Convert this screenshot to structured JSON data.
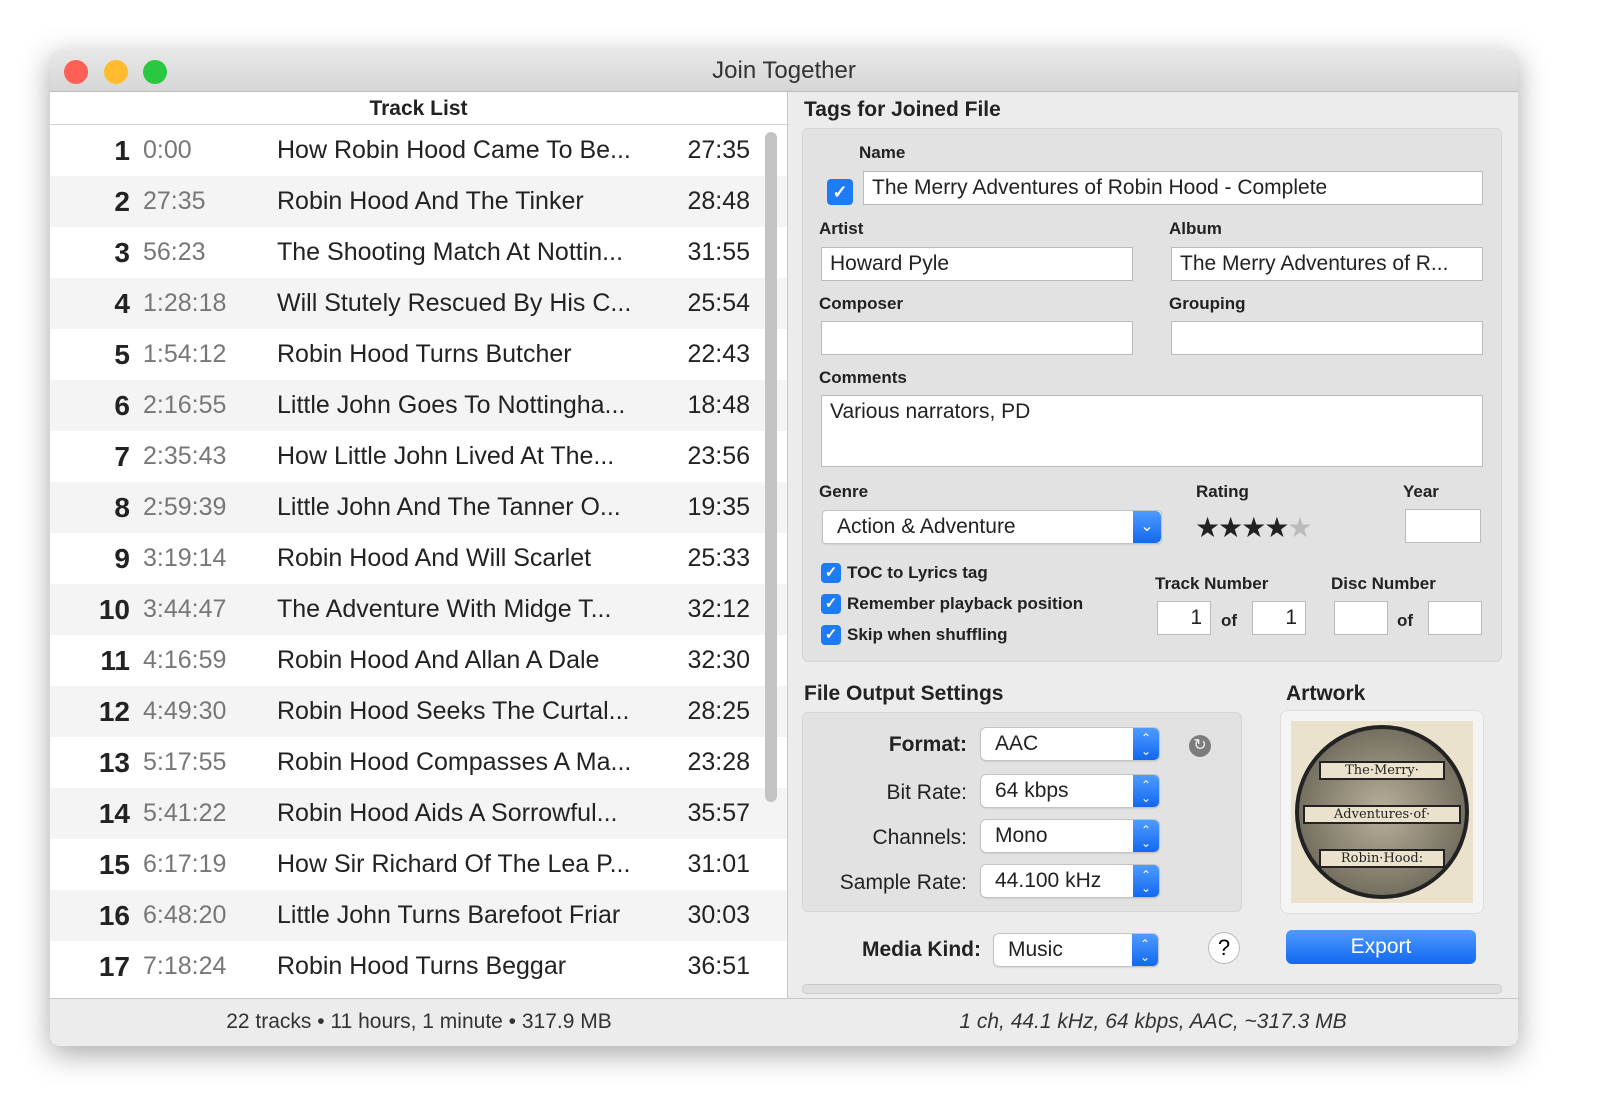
{
  "window": {
    "title": "Join Together"
  },
  "track_list": {
    "header": "Track List",
    "tracks": [
      {
        "n": "1",
        "start": "0:00",
        "name": "How Robin Hood Came To Be...",
        "dur": "27:35"
      },
      {
        "n": "2",
        "start": "27:35",
        "name": "Robin Hood And The Tinker",
        "dur": "28:48"
      },
      {
        "n": "3",
        "start": "56:23",
        "name": "The Shooting Match At Nottin...",
        "dur": "31:55"
      },
      {
        "n": "4",
        "start": "1:28:18",
        "name": "Will Stutely Rescued By His C...",
        "dur": "25:54"
      },
      {
        "n": "5",
        "start": "1:54:12",
        "name": "Robin Hood Turns Butcher",
        "dur": "22:43"
      },
      {
        "n": "6",
        "start": "2:16:55",
        "name": "Little John Goes To Nottingha...",
        "dur": "18:48"
      },
      {
        "n": "7",
        "start": "2:35:43",
        "name": "How Little John Lived At The...",
        "dur": "23:56"
      },
      {
        "n": "8",
        "start": "2:59:39",
        "name": "Little John And The Tanner O...",
        "dur": "19:35"
      },
      {
        "n": "9",
        "start": "3:19:14",
        "name": "Robin Hood And Will Scarlet",
        "dur": "25:33"
      },
      {
        "n": "10",
        "start": "3:44:47",
        "name": "The Adventure With Midge T...",
        "dur": "32:12"
      },
      {
        "n": "11",
        "start": "4:16:59",
        "name": "Robin Hood And Allan A Dale",
        "dur": "32:30"
      },
      {
        "n": "12",
        "start": "4:49:30",
        "name": "Robin Hood Seeks The Curtal...",
        "dur": "28:25"
      },
      {
        "n": "13",
        "start": "5:17:55",
        "name": "Robin Hood Compasses A Ma...",
        "dur": "23:28"
      },
      {
        "n": "14",
        "start": "5:41:22",
        "name": "Robin Hood Aids A Sorrowful...",
        "dur": "35:57"
      },
      {
        "n": "15",
        "start": "6:17:19",
        "name": "How Sir Richard Of The Lea P...",
        "dur": "31:01"
      },
      {
        "n": "16",
        "start": "6:48:20",
        "name": "Little John Turns Barefoot Friar",
        "dur": "30:03"
      },
      {
        "n": "17",
        "start": "7:18:24",
        "name": "Robin Hood Turns Beggar",
        "dur": "36:51"
      }
    ],
    "summary": "22 tracks • 11 hours, 1 minute • 317.9 MB"
  },
  "tags": {
    "header": "Tags for Joined File",
    "name_label": "Name",
    "name": "The Merry Adventures of Robin Hood - Complete",
    "name_checked": true,
    "artist_label": "Artist",
    "artist": "Howard Pyle",
    "album_label": "Album",
    "album": "The Merry Adventures of R...",
    "composer_label": "Composer",
    "composer": "",
    "grouping_label": "Grouping",
    "grouping": "",
    "comments_label": "Comments",
    "comments": "Various narrators, PD",
    "genre_label": "Genre",
    "genre": "Action & Adventure",
    "rating_label": "Rating",
    "rating": 4,
    "rating_max": 5,
    "year_label": "Year",
    "year": "",
    "checkboxes": [
      {
        "label": "TOC to Lyrics tag",
        "checked": true
      },
      {
        "label": "Remember playback position",
        "checked": true
      },
      {
        "label": "Skip when shuffling",
        "checked": true
      }
    ],
    "track_number_label": "Track Number",
    "track_number": "1",
    "track_of": "1",
    "of_label": "of",
    "disc_number_label": "Disc Number",
    "disc_number": "",
    "disc_of": ""
  },
  "output": {
    "header": "File Output Settings",
    "format_label": "Format:",
    "format": "AAC",
    "bitrate_label": "Bit Rate:",
    "bitrate": "64 kbps",
    "channels_label": "Channels:",
    "channels": "Mono",
    "samplerate_label": "Sample Rate:",
    "samplerate": "44.100 kHz",
    "mediakind_label": "Media Kind:",
    "mediakind": "Music",
    "help": "?"
  },
  "artwork": {
    "header": "Artwork",
    "text": [
      "The·Merry·",
      "Adventures·of·",
      "Robin·Hood:"
    ]
  },
  "export_label": "Export",
  "output_summary": "1 ch, 44.1 kHz, 64 kbps, AAC, ~317.3 MB",
  "colors": {
    "accent": "#1d7bf5",
    "close": "#fe5f57",
    "minimize": "#febc2e",
    "zoom": "#28c840"
  }
}
